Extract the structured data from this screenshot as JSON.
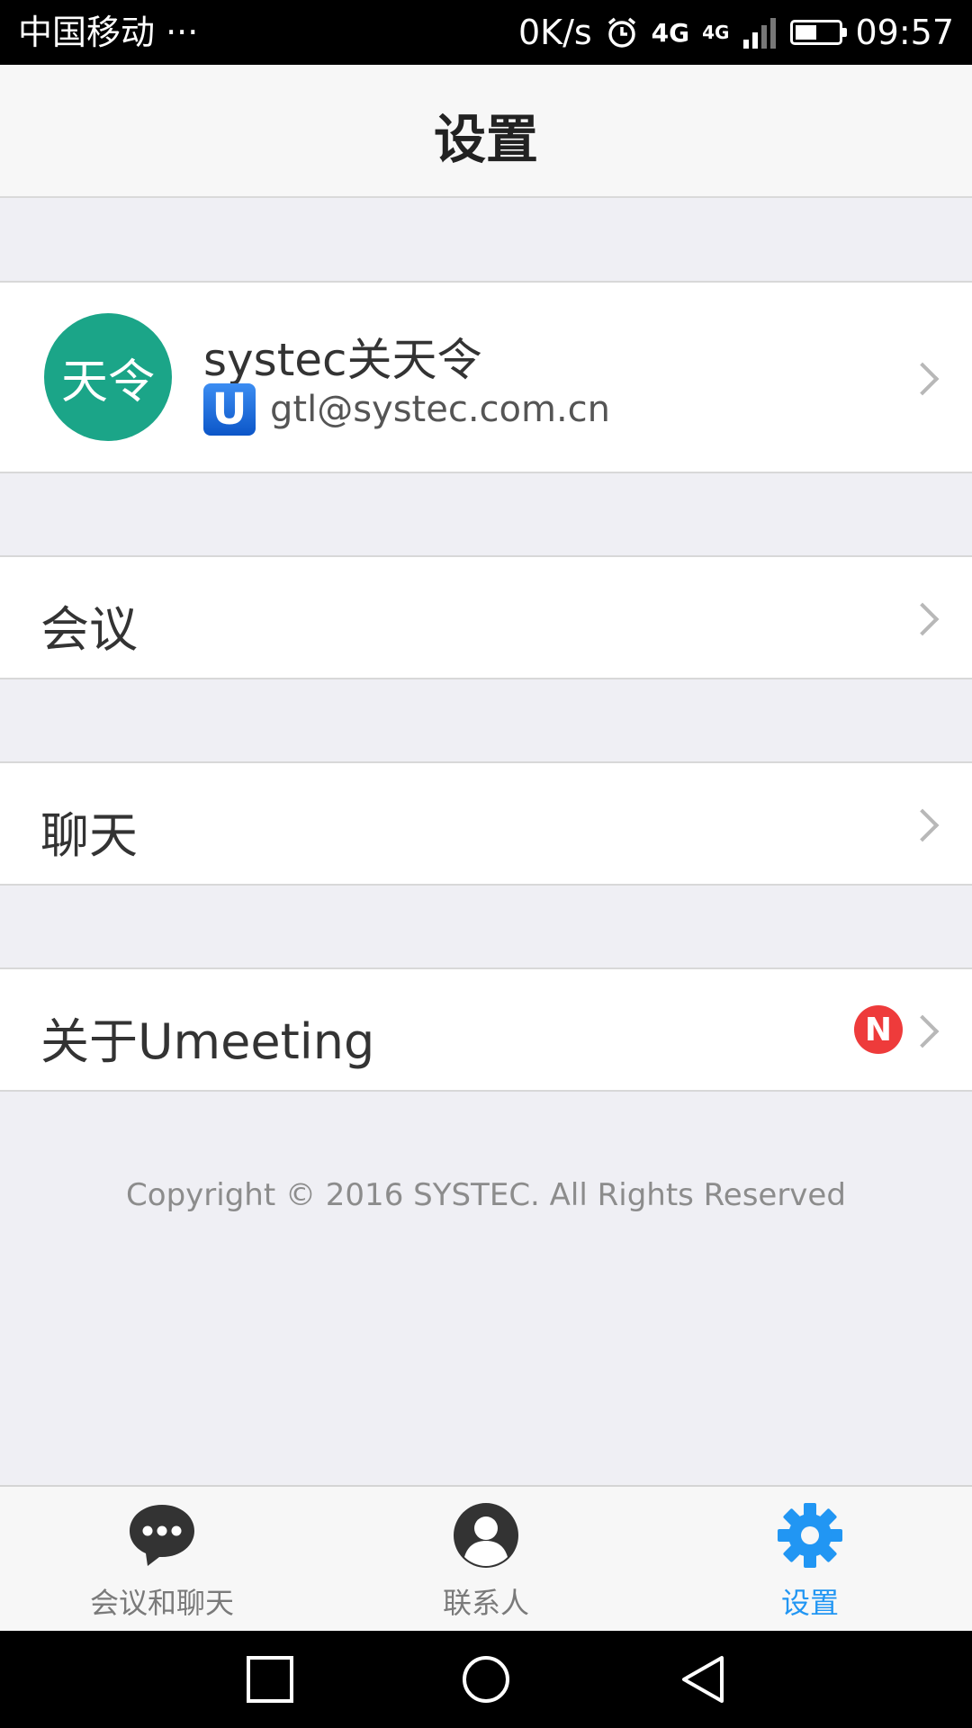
{
  "status_bar": {
    "carrier": "中国移动 ···",
    "net_speed": "0K/s",
    "net_type_1": "4G",
    "net_type_2": "4G",
    "time": "09:57",
    "battery_level": 0.5
  },
  "header": {
    "title": "设置"
  },
  "profile": {
    "avatar_text": "天令",
    "avatar_color": "#1ba588",
    "name": "systec关天令",
    "badge": "U",
    "email": "gtl@systec.com.cn"
  },
  "menu": {
    "meeting": "会议",
    "chat": "聊天",
    "about": "关于Umeeting",
    "about_badge": "N"
  },
  "footer": {
    "copyright": "Copyright © 2016 SYSTEC. All Rights Reserved"
  },
  "tabs": {
    "meetings_chat": "会议和聊天",
    "contacts": "联系人",
    "settings": "设置",
    "active_color": "#2196f3"
  },
  "icons": {
    "alarm": "alarm-icon",
    "signal": "signal-icon",
    "battery": "battery-icon",
    "chevron": "chevron-right-icon",
    "chat_bubble": "chat-bubble-icon",
    "contact": "contact-icon",
    "gear": "gear-icon"
  }
}
